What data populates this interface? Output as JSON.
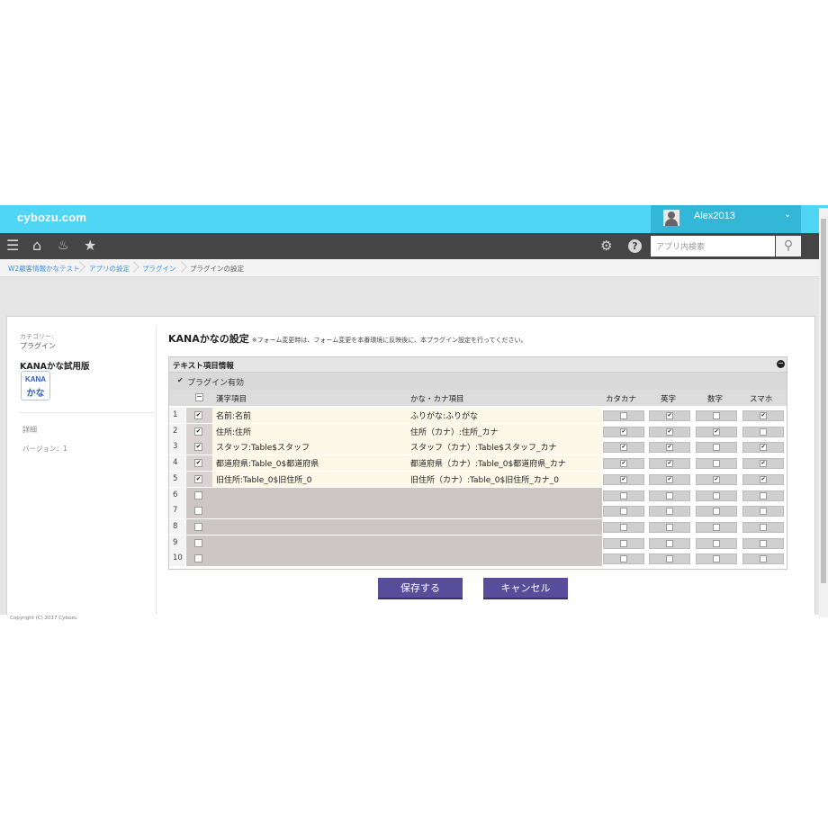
{
  "app": {
    "logo": "cybozu.com"
  },
  "user": {
    "name": "Alex2013"
  },
  "nav": {
    "search_placeholder": "アプリ内検索"
  },
  "breadcrumb": [
    "W2顧客情報かなテスト",
    "アプリの設定",
    "プラグイン",
    "プラグインの設定"
  ],
  "sidebar": {
    "category_label": "カテゴリー:",
    "category": "プラグイン",
    "plugin_name": "KANAかな試用版",
    "logo_line1": "KANA",
    "logo_line2": "かな",
    "detail_link": "詳細",
    "version": "バージョン：1"
  },
  "main": {
    "title": "KANAかなの設定",
    "note": "※フォーム変更時は、フォーム変更を本番環境に反映後に、本プラグイン設定を行ってください。",
    "panel_title": "テキスト項目情報",
    "enable_label": "プラグイン有効",
    "enable_checked": true,
    "headers": {
      "kanji": "漢字項目",
      "kana": "かな・カナ項目",
      "katakana": "カタカナ",
      "eiji": "英字",
      "suji": "数字",
      "smartphone": "スマホ"
    },
    "rows": [
      {
        "num": "1",
        "enabled": true,
        "kanji": "名前:名前",
        "kana": "ふりがな:ふりがな",
        "katakana": false,
        "eiji": true,
        "suji": false,
        "smartphone": true
      },
      {
        "num": "2",
        "enabled": true,
        "kanji": "住所:住所",
        "kana": "住所（カナ）:住所_カナ",
        "katakana": true,
        "eiji": true,
        "suji": true,
        "smartphone": false
      },
      {
        "num": "3",
        "enabled": true,
        "kanji": "スタッフ:Table$スタッフ",
        "kana": "スタッフ（カナ）:Table$スタッフ_カナ",
        "katakana": true,
        "eiji": true,
        "suji": false,
        "smartphone": true
      },
      {
        "num": "4",
        "enabled": true,
        "kanji": "都道府県:Table_0$都道府県",
        "kana": "都道府県（カナ）:Table_0$都道府県_カナ",
        "katakana": true,
        "eiji": true,
        "suji": false,
        "smartphone": true
      },
      {
        "num": "5",
        "enabled": true,
        "kanji": "旧住所:Table_0$旧住所_0",
        "kana": "旧住所（カナ）:Table_0$旧住所_カナ_0",
        "katakana": true,
        "eiji": true,
        "suji": true,
        "smartphone": true
      },
      {
        "num": "6",
        "enabled": false,
        "kanji": "",
        "kana": "",
        "katakana": false,
        "eiji": false,
        "suji": false,
        "smartphone": false
      },
      {
        "num": "7",
        "enabled": false,
        "kanji": "",
        "kana": "",
        "katakana": false,
        "eiji": false,
        "suji": false,
        "smartphone": false
      },
      {
        "num": "8",
        "enabled": false,
        "kanji": "",
        "kana": "",
        "katakana": false,
        "eiji": false,
        "suji": false,
        "smartphone": false
      },
      {
        "num": "9",
        "enabled": false,
        "kanji": "",
        "kana": "",
        "katakana": false,
        "eiji": false,
        "suji": false,
        "smartphone": false
      },
      {
        "num": "10",
        "enabled": false,
        "kanji": "",
        "kana": "",
        "katakana": false,
        "eiji": false,
        "suji": false,
        "smartphone": false
      }
    ],
    "save_label": "保存する",
    "cancel_label": "キャンセル"
  },
  "footer": {
    "copyright": "Copyright (C) 2017 Cybozu"
  },
  "colors": {
    "header": "#4fd6f5",
    "userbox": "#33b7d6",
    "navbar": "#454545",
    "button": "#574d9a",
    "active_row": "#fbf8e7",
    "inactive_row": "#cdc6c6"
  }
}
